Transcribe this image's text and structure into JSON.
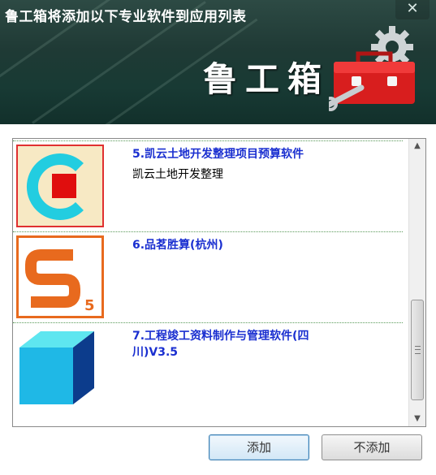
{
  "window": {
    "title": "鲁工箱将添加以下专业软件到应用列表",
    "close_glyph": "✕"
  },
  "banner": {
    "brand_text": "鲁工箱",
    "logo_icon": "toolbox-gear-icon"
  },
  "items": [
    {
      "name": "5.凯云土地开发整理项目预算软件",
      "desc": "凯云土地开发整理",
      "icon": "kaiyun-c-logo-icon"
    },
    {
      "name": "6.品茗胜算(杭州)",
      "desc": "",
      "icon": "pinming-s5-logo-icon"
    },
    {
      "name": "7.工程竣工资料制作与管理软件(四川)V3.5",
      "desc": "",
      "icon": "blue-cube-icon"
    }
  ],
  "scrollbar": {
    "up_glyph": "▲",
    "down_glyph": "▼"
  },
  "buttons": {
    "add_label": "添加",
    "cancel_label": "不添加"
  },
  "colors": {
    "header_bg": "#1f3a35",
    "item_name": "#1a2fd0",
    "accent_red": "#e02020"
  }
}
